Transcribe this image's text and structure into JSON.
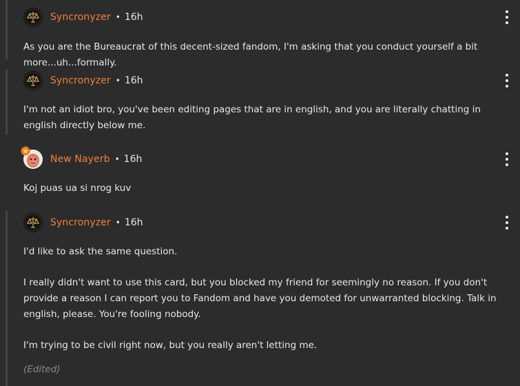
{
  "comments": [
    {
      "author": "Syncronyzer",
      "separator": "•",
      "time": "16h",
      "avatar_icon": "scales-icon",
      "paragraphs": [
        "As you are the Bureaucrat of this decent-sized fandom, I'm asking that you conduct yourself a bit more...uh...formally."
      ]
    },
    {
      "author": "Syncronyzer",
      "separator": "•",
      "time": "16h",
      "avatar_icon": "scales-icon",
      "paragraphs": [
        "I'm not an idiot bro, you've been editing pages that are in english, and you are literally chatting in english directly below me."
      ]
    },
    {
      "author": "New Nayerb",
      "separator": "•",
      "time": "16h",
      "avatar_icon": "pink-character-icon",
      "badge_icon": "star-badge-icon",
      "paragraphs": [
        "Koj puas ua si nrog kuv"
      ]
    },
    {
      "author": "Syncronyzer",
      "separator": "•",
      "time": "16h",
      "avatar_icon": "scales-icon",
      "paragraphs": [
        "I'd like to ask the same question.",
        "I really didn't want to use this card, but you blocked my friend for seemingly no reason. If you don't provide a reason I can report you to Fandom and have you demoted for unwarranted blocking. Talk in english, please. You're fooling nobody.",
        "I'm trying to be civil right now, but you really aren't letting me."
      ],
      "edited_label": "(Edited)"
    }
  ],
  "colors": {
    "background": "#2c2c2c",
    "author": "#f0803a",
    "text": "#e8e8e8",
    "rail": "#454545",
    "edited": "#8a8a8a"
  }
}
